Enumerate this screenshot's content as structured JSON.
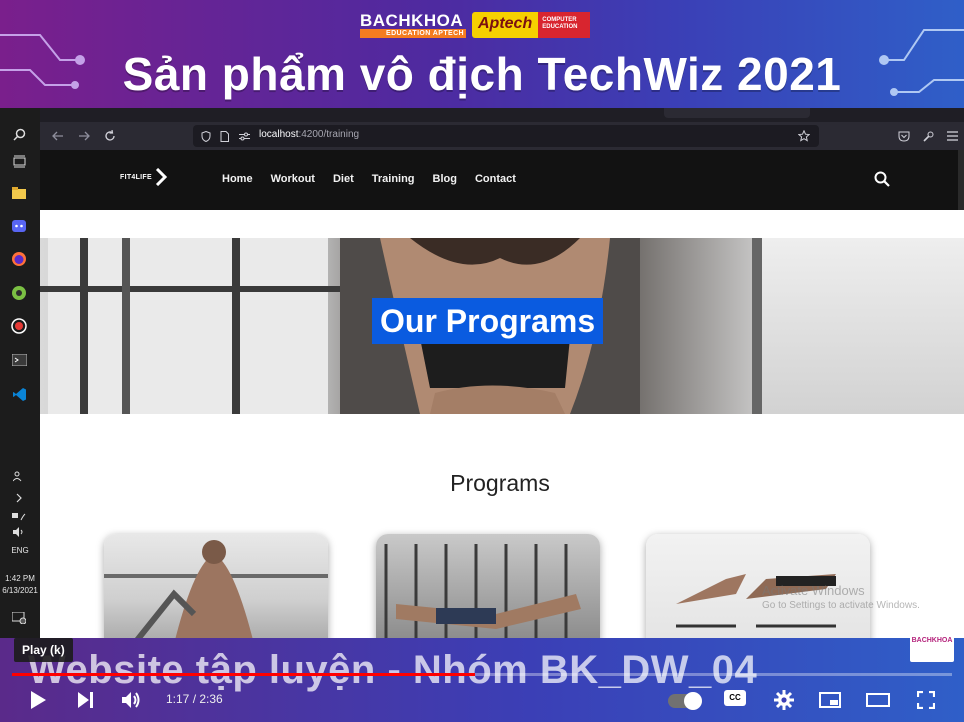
{
  "banner": {
    "title": "Sản phẩm vô địch TechWiz 2021",
    "logo_bachkhoa": "BACHKHOA",
    "logo_bachkhoa_sub": "EDUCATION APTECH",
    "logo_aptech": "Aptech",
    "logo_aptech_side": "COMPUTER EDUCATION"
  },
  "taskbar": {
    "language": "ENG",
    "time": "1:42 PM",
    "date": "6/13/2021"
  },
  "browser": {
    "url_host": "localhost",
    "url_path": ":4200/training"
  },
  "site": {
    "brand": "FIT4LIFE",
    "nav": [
      "Home",
      "Workout",
      "Diet",
      "Training",
      "Blog",
      "Contact"
    ],
    "hero_title": "Our Programs",
    "section_title": "Programs",
    "watermark_line1": "Activate Windows",
    "watermark_line2": "Go to Settings to activate Windows."
  },
  "player": {
    "tooltip": "Play (k)",
    "bottom_title": "Website tập luyện - Nhóm BK_DW_04",
    "time_current": "1:17",
    "time_total": "2:36",
    "progress": 0.493,
    "badge": "BACHKHOA",
    "cc_label": "CC"
  },
  "colors": {
    "hero_title_bg": "#0a5be0",
    "progress": "#ff0000"
  }
}
